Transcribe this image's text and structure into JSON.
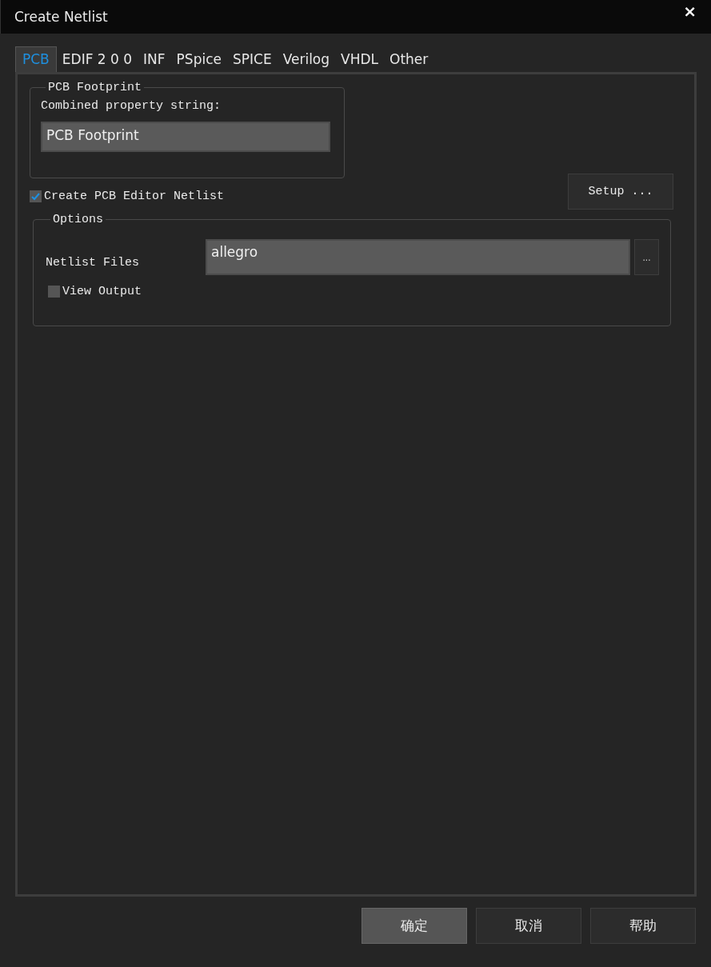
{
  "window": {
    "title": "Create Netlist",
    "close": "×"
  },
  "tabs": [
    {
      "label": "PCB",
      "selected": true
    },
    {
      "label": "EDIF 2 0 0",
      "selected": false
    },
    {
      "label": "INF",
      "selected": false
    },
    {
      "label": "PSpice",
      "selected": false
    },
    {
      "label": "SPICE",
      "selected": false
    },
    {
      "label": "Verilog",
      "selected": false
    },
    {
      "label": "VHDL",
      "selected": false
    },
    {
      "label": "Other",
      "selected": false
    }
  ],
  "footprint_group": {
    "title": "PCB Footprint",
    "label": "Combined property string:",
    "value": "PCB Footprint"
  },
  "create_netlist": {
    "label": "Create PCB Editor Netlist",
    "checked": true
  },
  "setup_button": "Setup ...",
  "options_group": {
    "title": "Options",
    "directory_label": "Netlist Files",
    "directory_value": "allegro",
    "browse": "...",
    "view_output": {
      "label": "View Output",
      "checked": false
    }
  },
  "buttons": [
    {
      "label": "确定",
      "default": true
    },
    {
      "label": "取消",
      "default": false
    },
    {
      "label": "帮助",
      "default": false
    }
  ]
}
